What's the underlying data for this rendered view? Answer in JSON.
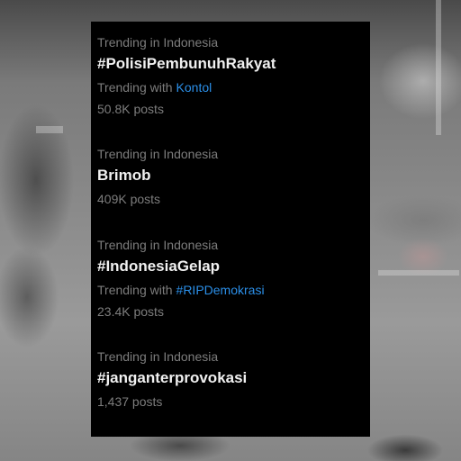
{
  "trends": [
    {
      "context": "Trending in Indonesia",
      "title": "#PolisiPembunuhRakyat",
      "with_label": "Trending with",
      "with_tag": "Kontol",
      "count": "50.8K posts"
    },
    {
      "context": "Trending in Indonesia",
      "title": "Brimob",
      "count": "409K posts"
    },
    {
      "context": "Trending in Indonesia",
      "title": "#IndonesiaGelap",
      "with_label": "Trending with",
      "with_tag": "#RIPDemokrasi",
      "count": "23.4K posts"
    },
    {
      "context": "Trending in Indonesia",
      "title": "#janganterprovokasi",
      "count": "1,437 posts"
    }
  ],
  "colors": {
    "panel_background": "#000000",
    "primary_text": "#f0f0f0",
    "secondary_text": "#7d7d7d",
    "link": "#2b8fe8"
  }
}
